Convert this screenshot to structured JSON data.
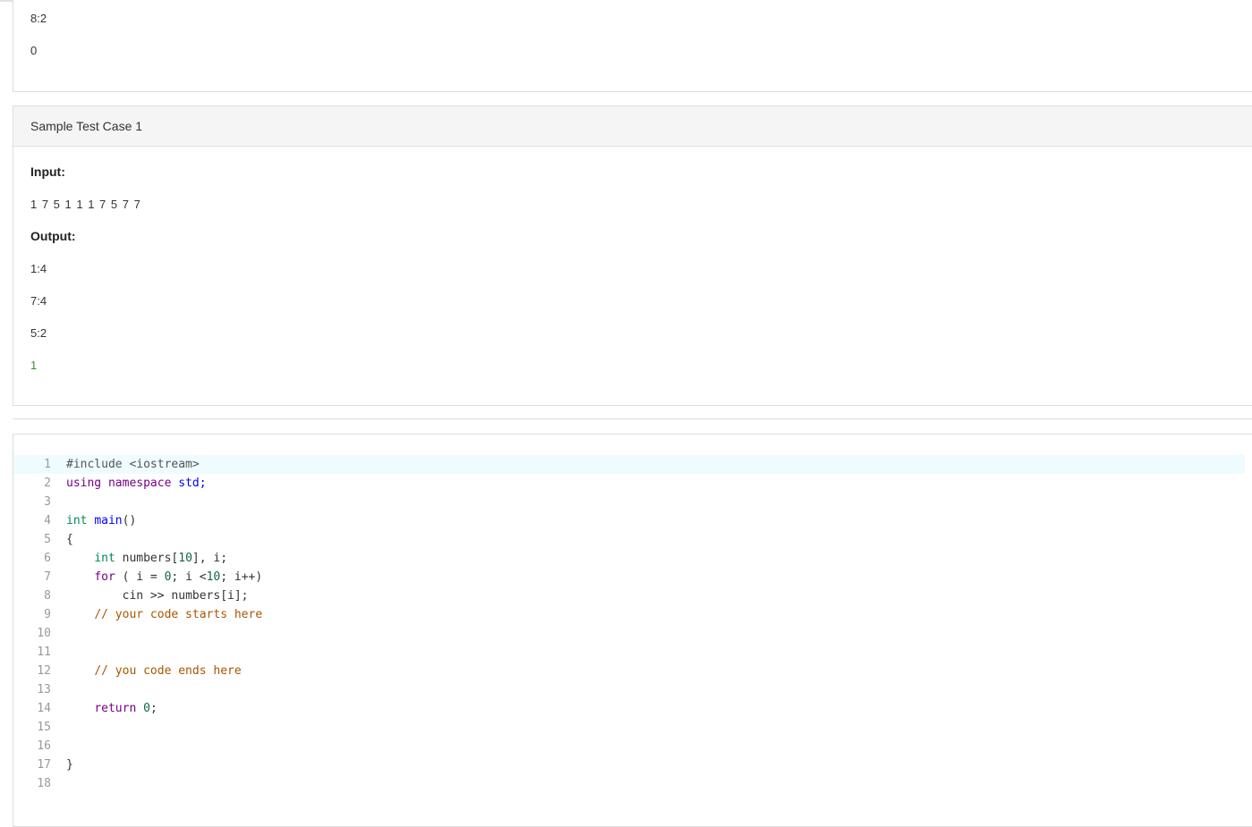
{
  "previous_case": {
    "output_lines": [
      "8:2",
      "0"
    ]
  },
  "sample_case": {
    "title": "Sample Test Case 1",
    "input_label": "Input:",
    "input_value": "1 7 5 1 1 1 7 5 7 7",
    "output_label": "Output:",
    "output_lines": [
      "1:4",
      "7:4",
      "5:2",
      "1"
    ]
  },
  "editor": {
    "line_numbers": [
      "1",
      "2",
      "3",
      "4",
      "5",
      "6",
      "7",
      "8",
      "9",
      "10",
      "11",
      "12",
      "13",
      "14",
      "15",
      "16",
      "17",
      "18"
    ],
    "lines": {
      "l1": "#include <iostream>",
      "l2_kw": "using",
      "l2_kw2": "namespace",
      "l2_rest": "std;",
      "l4_type": "int",
      "l4_def": "main",
      "l4_rest": "()",
      "l5": "{",
      "l6_type": "int",
      "l6_a": " numbers[",
      "l6_num": "10",
      "l6_b": "], i;",
      "l7_kw": "for",
      "l7_a": " ( i = ",
      "l7_num1": "0",
      "l7_b": "; i <",
      "l7_num2": "10",
      "l7_c": "; i++)",
      "l8": "cin >> numbers[i];",
      "l9": "// your code starts here",
      "l12": "// you code ends here",
      "l14_kw": "return",
      "l14_num": "0",
      "l14_rest": ";",
      "l17": "}"
    },
    "colors": {
      "active_line": "#eefbff",
      "keyword": "#770088",
      "type": "#008855",
      "definition": "#0000ff",
      "number": "#116644",
      "comment": "#aa5500"
    }
  }
}
